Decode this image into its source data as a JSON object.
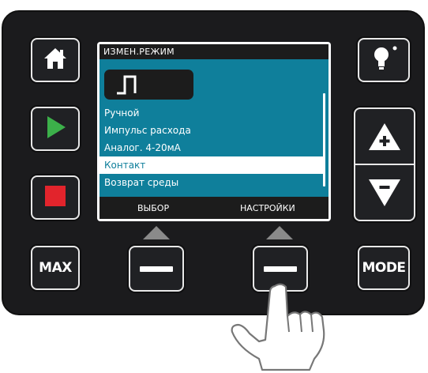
{
  "screen": {
    "title": "ИЗМЕН.РЕЖИМ",
    "menu_items": [
      "Ручной",
      "Импульс расхода",
      "Аналог. 4-20мА",
      "Контакт",
      "Возврат среды"
    ],
    "selected_index": 3,
    "softkey_left": "ВЫБОР",
    "softkey_right": "НАСТРОЙКИ"
  },
  "buttons": {
    "max_label": "MAX",
    "mode_label": "MODE"
  },
  "icons": {
    "home": "home-icon",
    "play": "play-icon",
    "stop": "stop-icon",
    "light": "lightbulb-icon",
    "plus": "plus-arrow-icon",
    "minus": "minus-arrow-icon",
    "mode_symbol": "pulse-wave-icon",
    "hand": "pointing-hand-icon"
  },
  "colors": {
    "screen_bg": "#0f7f9b",
    "play": "#3cb04a",
    "stop": "#e2242c",
    "panel": "#1b1b1d"
  }
}
